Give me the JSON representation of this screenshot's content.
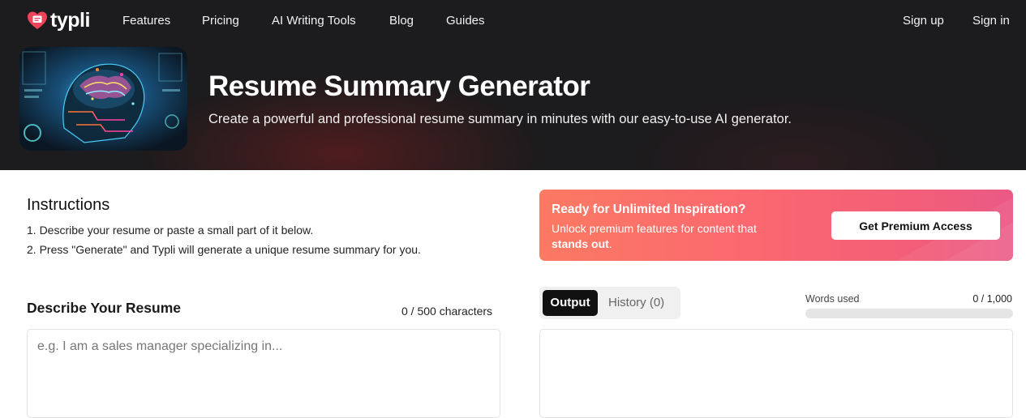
{
  "brand": {
    "name": "typli"
  },
  "nav": {
    "links": [
      "Features",
      "Pricing",
      "AI Writing Tools",
      "Blog",
      "Guides"
    ],
    "sign_up": "Sign up",
    "sign_in": "Sign in"
  },
  "hero": {
    "title": "Resume Summary Generator",
    "subtitle": "Create a powerful and professional resume summary in minutes with our easy-to-use AI generator."
  },
  "instructions": {
    "title": "Instructions",
    "steps": [
      "1. Describe your resume or paste a small part of it below.",
      "2. Press \"Generate\" and Typli will generate a unique resume summary for you."
    ]
  },
  "promo": {
    "title": "Ready for Unlimited Inspiration?",
    "line1": "Unlock premium features for content that",
    "line2_bold": "stands out",
    "line2_end": ".",
    "button": "Get Premium Access"
  },
  "input": {
    "label": "Describe Your Resume",
    "char_count": "0 / 500 characters",
    "placeholder": "e.g. I am a sales manager specializing in...",
    "value": ""
  },
  "output": {
    "tabs": [
      "Output",
      "History (0)"
    ],
    "active_tab": "Output",
    "words_label": "Words used",
    "words_value": "0 / 1,000",
    "words_fraction": 0
  },
  "colors": {
    "hero_bg": "#1c1b1d",
    "brand_accent": "#f0445a",
    "promo_start": "#fb7a62",
    "promo_end": "#ea5a86"
  }
}
